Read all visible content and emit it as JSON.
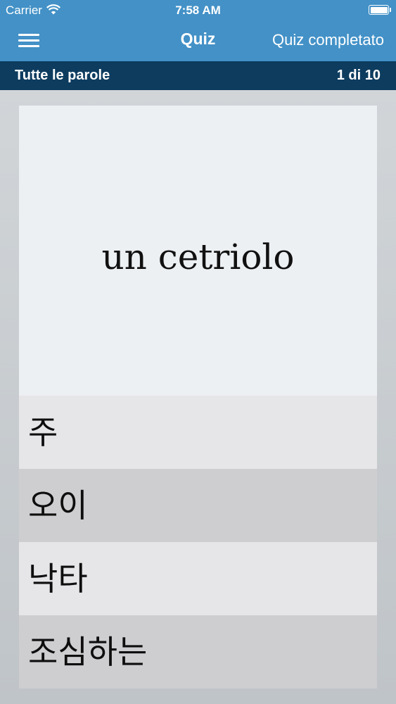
{
  "status_bar": {
    "carrier": "Carrier",
    "time": "7:58 AM",
    "wifi_icon": "wifi-icon",
    "battery_icon": "battery-icon"
  },
  "nav": {
    "menu_icon": "hamburger-menu-icon",
    "title": "Quiz",
    "right_action": "Quiz completato"
  },
  "subheader": {
    "category": "Tutte le parole",
    "progress": "1 di 10"
  },
  "question": {
    "word": "un cetriolo"
  },
  "answers": [
    {
      "label": "주"
    },
    {
      "label": "오이"
    },
    {
      "label": "낙타"
    },
    {
      "label": "조심하는"
    }
  ],
  "colors": {
    "navbar": "#4391c7",
    "subbar": "#0d3c5f",
    "card": "#edf0f3",
    "answer_light": "#e6e5e8",
    "answer_dark": "#cecdd0"
  }
}
